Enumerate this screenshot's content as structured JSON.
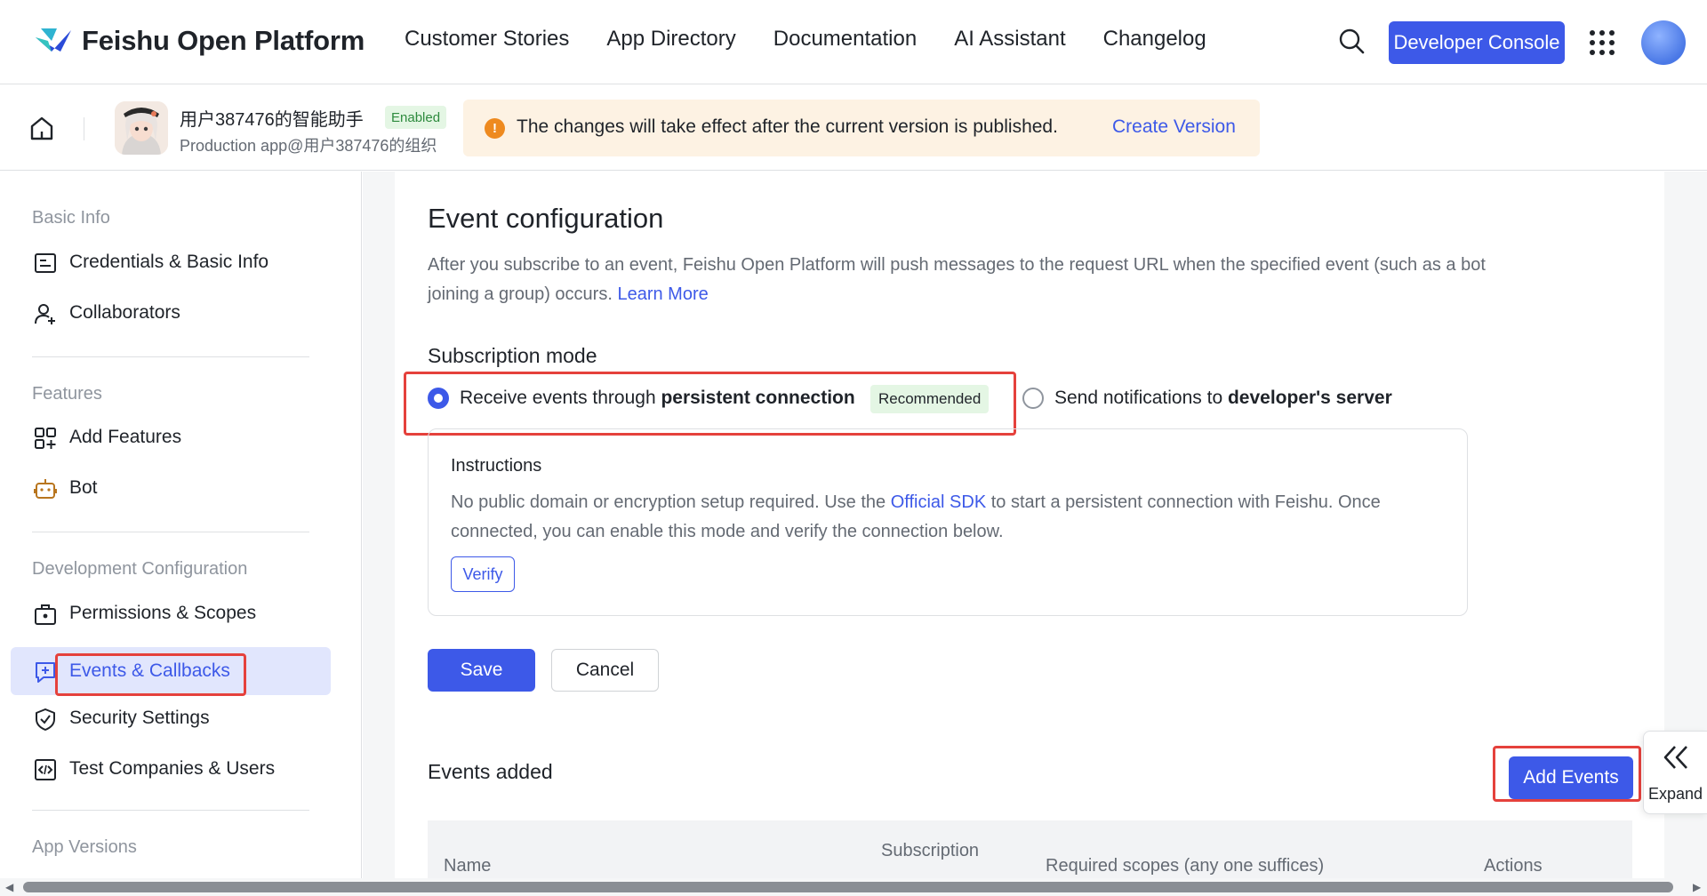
{
  "header": {
    "brand": "Feishu Open Platform",
    "nav": [
      {
        "label": "Customer Stories"
      },
      {
        "label": "App Directory"
      },
      {
        "label": "Documentation"
      },
      {
        "label": "AI Assistant"
      },
      {
        "label": "Changelog"
      }
    ],
    "console_button": "Developer Console",
    "icons": {
      "search": "search-icon",
      "apps": "apps-grid-icon",
      "avatar": "user-avatar"
    }
  },
  "subheader": {
    "app_name": "用户387476的智能助手",
    "status_badge": "Enabled",
    "app_subtitle": "Production app@用户387476的组织",
    "notice_text": "The changes will take effect after the current version is published.",
    "notice_link": "Create Version"
  },
  "sidebar": {
    "groups": [
      {
        "title": "Basic Info",
        "items": [
          {
            "label": "Credentials & Basic Info",
            "icon": "id-card-icon"
          },
          {
            "label": "Collaborators",
            "icon": "user-add-icon"
          }
        ]
      },
      {
        "title": "Features",
        "items": [
          {
            "label": "Add Features",
            "icon": "add-features-icon"
          },
          {
            "label": "Bot",
            "icon": "bot-icon"
          }
        ]
      },
      {
        "title": "Development Configuration",
        "items": [
          {
            "label": "Permissions & Scopes",
            "icon": "permissions-icon"
          },
          {
            "label": "Events & Callbacks",
            "icon": "events-icon",
            "active": true
          },
          {
            "label": "Security Settings",
            "icon": "shield-icon"
          },
          {
            "label": "Test Companies & Users",
            "icon": "code-icon"
          }
        ]
      },
      {
        "title": "App Versions",
        "items": []
      }
    ]
  },
  "main": {
    "title": "Event configuration",
    "description": "After you subscribe to an event, Feishu Open Platform will push messages to the request URL when the specified event (such as a bot joining a group) occurs.",
    "learn_more": "Learn More",
    "subscription_mode_title": "Subscription mode",
    "options": [
      {
        "prefix": "Receive events through",
        "bold": "persistent connection",
        "badge": "Recommended",
        "selected": true
      },
      {
        "prefix": "Send notifications to",
        "bold": "developer's server",
        "selected": false
      }
    ],
    "instructions": {
      "title": "Instructions",
      "text_before": "No public domain or encryption setup required. Use the",
      "link": "Official SDK",
      "text_after": "to start a persistent connection with Feishu. Once connected, you can enable this mode and verify the connection below.",
      "verify_button": "Verify"
    },
    "save_button": "Save",
    "cancel_button": "Cancel",
    "events_added_title": "Events added",
    "add_events_button": "Add Events",
    "table_headers": [
      "Name",
      "Subscription",
      "Required scopes (any one suffices)",
      "Actions"
    ]
  },
  "expand_tab": {
    "label": "Expand"
  },
  "colors": {
    "accent": "#3d59e8",
    "highlight": "#e5413c",
    "badge_bg": "#e4f6e4",
    "notice_bg": "#fdf2e3"
  }
}
